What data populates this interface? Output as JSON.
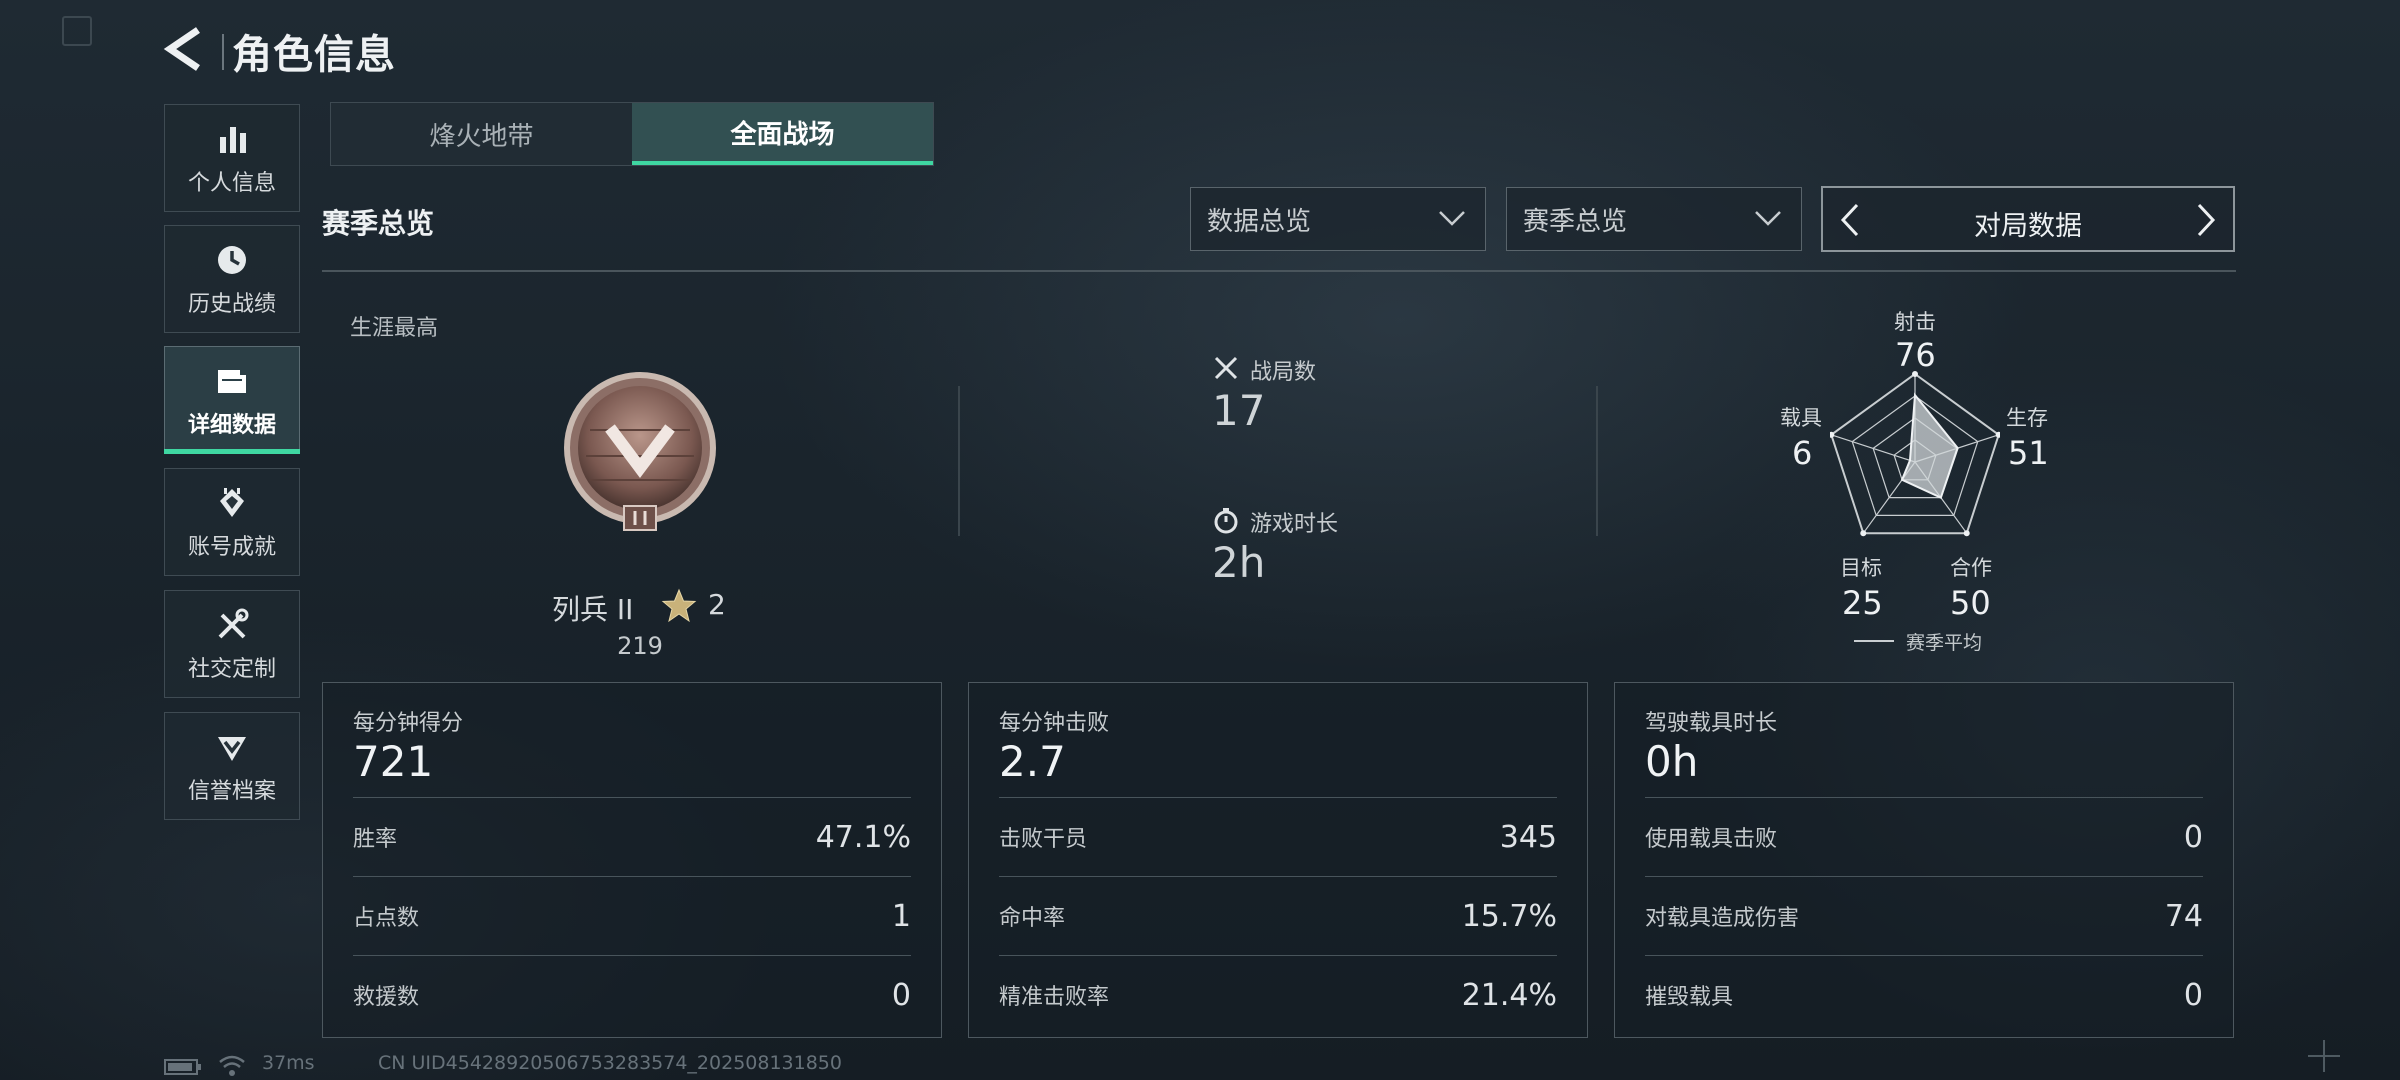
{
  "header": {
    "title": "角色信息"
  },
  "sidebar": {
    "items": [
      {
        "label": "个人信息",
        "icon": "bar-chart-icon"
      },
      {
        "label": "历史战绩",
        "icon": "clock-icon"
      },
      {
        "label": "详细数据",
        "icon": "folder-icon",
        "active": true
      },
      {
        "label": "账号成就",
        "icon": "achievement-icon"
      },
      {
        "label": "社交定制",
        "icon": "tools-icon"
      },
      {
        "label": "信誉档案",
        "icon": "reputation-icon"
      }
    ]
  },
  "mode_tabs": [
    {
      "label": "烽火地带",
      "active": false
    },
    {
      "label": "全面战场",
      "active": true
    }
  ],
  "section": {
    "title": "赛季总览",
    "dropdown1": "数据总览",
    "dropdown2": "赛季总览",
    "pager_label": "对局数据"
  },
  "overview": {
    "career_label": "生涯最高",
    "rank_name": "列兵 II",
    "stars": "2",
    "rank_points": "219",
    "matches_label": "战局数",
    "matches_value": "17",
    "playtime_label": "游戏时长",
    "playtime_value": "2h"
  },
  "radar": {
    "axes": [
      {
        "label": "射击",
        "value": "76"
      },
      {
        "label": "生存",
        "value": "51"
      },
      {
        "label": "合作",
        "value": "50"
      },
      {
        "label": "目标",
        "value": "25"
      },
      {
        "label": "载具",
        "value": "6"
      }
    ],
    "legend": "赛季平均"
  },
  "cards": [
    {
      "head_label": "每分钟得分",
      "head_value": "721",
      "rows": [
        {
          "label": "胜率",
          "value": "47.1%"
        },
        {
          "label": "占点数",
          "value": "1"
        },
        {
          "label": "救援数",
          "value": "0"
        }
      ]
    },
    {
      "head_label": "每分钟击败",
      "head_value": "2.7",
      "rows": [
        {
          "label": "击败干员",
          "value": "345"
        },
        {
          "label": "命中率",
          "value": "15.7%"
        },
        {
          "label": "精准击败率",
          "value": "21.4%"
        }
      ]
    },
    {
      "head_label": "驾驶载具时长",
      "head_value": "0h",
      "rows": [
        {
          "label": "使用载具击败",
          "value": "0"
        },
        {
          "label": "对载具造成伤害",
          "value": "74"
        },
        {
          "label": "摧毁载具",
          "value": "0"
        }
      ]
    }
  ],
  "status": {
    "ping": "37ms",
    "uid": "CN UID4542892050675328357​4_202508131850"
  },
  "colors": {
    "accent": "#3fd7a2"
  }
}
